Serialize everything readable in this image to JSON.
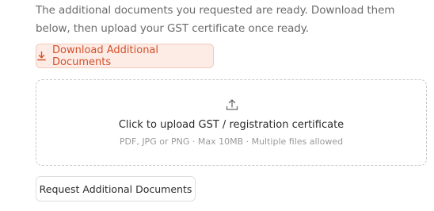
{
  "intro": {
    "text": "The additional documents you requested are ready. Download them below, then upload your GST certificate once ready."
  },
  "download_button": {
    "label": "Download Additional Documents",
    "icon": "download-icon",
    "color": "#d4502a"
  },
  "upload": {
    "icon": "upload-icon",
    "title": "Click to upload GST / registration certificate",
    "subtitle": "PDF, JPG or PNG · Max 10MB · Multiple files allowed"
  },
  "request_button": {
    "label": "Request Additional Documents"
  }
}
